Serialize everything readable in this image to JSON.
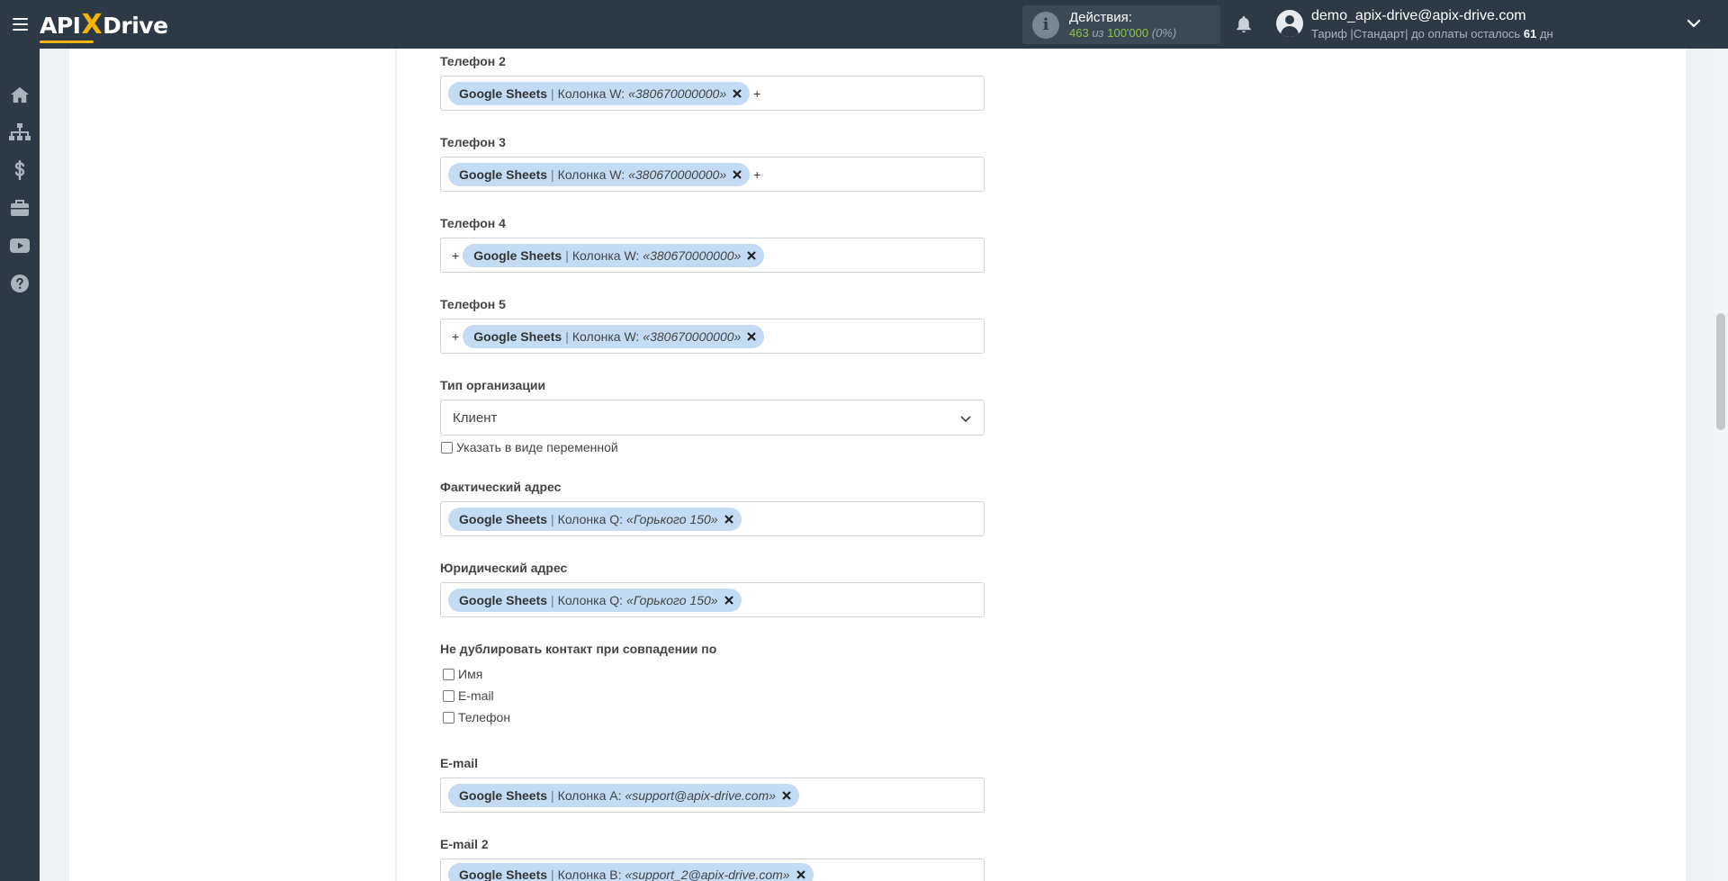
{
  "header": {
    "logo_left": "API",
    "logo_x": "X",
    "logo_right": "Drive",
    "actions_label": "Действия:",
    "actions_used": "463",
    "actions_of": "из",
    "actions_total": "100'000",
    "actions_percent": "(0%)",
    "user_email": "demo_apix-drive@apix-drive.com",
    "plan_prefix": "Тариф |Стандарт| до оплаты осталось",
    "plan_days": "61",
    "plan_suffix": "дн"
  },
  "sidebar": {
    "items": [
      {
        "icon": "home-icon"
      },
      {
        "icon": "sitemap-icon"
      },
      {
        "icon": "dollar-icon"
      },
      {
        "icon": "briefcase-icon"
      },
      {
        "icon": "youtube-icon"
      },
      {
        "icon": "help-icon"
      }
    ]
  },
  "form": {
    "phone2": {
      "label": "Телефон 2",
      "source": "Google Sheets",
      "column": "Колонка W:",
      "value": "«380670000000»",
      "plus": "+"
    },
    "phone3": {
      "label": "Телефон 3",
      "source": "Google Sheets",
      "column": "Колонка W:",
      "value": "«380670000000»",
      "plus": "+"
    },
    "phone4": {
      "label": "Телефон 4",
      "source": "Google Sheets",
      "column": "Колонка W:",
      "value": "«380670000000»",
      "plus": "+"
    },
    "phone5": {
      "label": "Телефон 5",
      "source": "Google Sheets",
      "column": "Колонка W:",
      "value": "«380670000000»",
      "plus": "+"
    },
    "org_type": {
      "label": "Тип организации",
      "selected": "Клиент",
      "variable_checkbox": "Указать в виде переменной"
    },
    "actual_address": {
      "label": "Фактический адрес",
      "source": "Google Sheets",
      "column": "Колонка Q:",
      "value": "«Горького 150»"
    },
    "legal_address": {
      "label": "Юридический адрес",
      "source": "Google Sheets",
      "column": "Колонка Q:",
      "value": "«Горького 150»"
    },
    "no_duplicate": {
      "label": "Не дублировать контакт при совпадении по",
      "options": [
        "Имя",
        "E-mail",
        "Телефон"
      ]
    },
    "email": {
      "label": "E-mail",
      "source": "Google Sheets",
      "column": "Колонка A:",
      "value": "«support@apix-drive.com»"
    },
    "email2": {
      "label": "E-mail 2",
      "source": "Google Sheets",
      "column": "Колонка B:",
      "value": "«support_2@apix-drive.com»"
    }
  },
  "colors": {
    "topbar": "#2d3a45",
    "accent": "#f7b500",
    "tag_bg": "#c3dcf3",
    "actions_green": "#8bc34a"
  }
}
